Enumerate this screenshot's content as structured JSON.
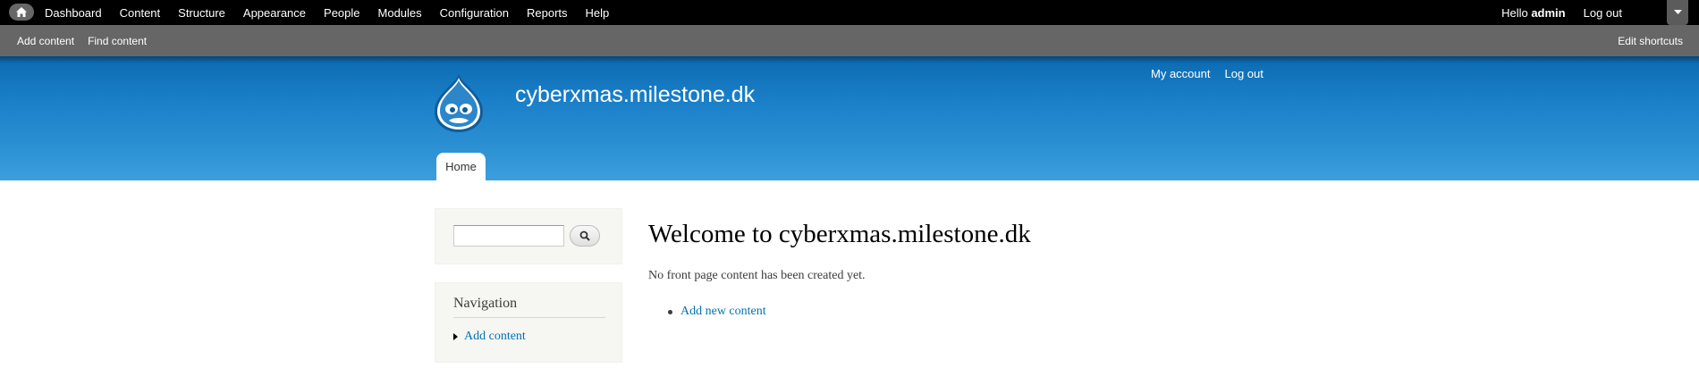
{
  "toolbar": {
    "home_icon": "home-icon",
    "menu": [
      {
        "label": "Dashboard"
      },
      {
        "label": "Content"
      },
      {
        "label": "Structure"
      },
      {
        "label": "Appearance"
      },
      {
        "label": "People"
      },
      {
        "label": "Modules"
      },
      {
        "label": "Configuration"
      },
      {
        "label": "Reports"
      },
      {
        "label": "Help"
      }
    ],
    "hello_prefix": "Hello",
    "username": "admin",
    "logout_label": "Log out",
    "drawer_icon": "chevron-down-icon"
  },
  "shortcuts": {
    "items": [
      {
        "label": "Add content"
      },
      {
        "label": "Find content"
      }
    ],
    "edit_label": "Edit shortcuts"
  },
  "header": {
    "logo_icon": "drupal-drop-logo",
    "site_name": "cyberxmas.milestone.dk",
    "secondary_menu": [
      {
        "label": "My account"
      },
      {
        "label": "Log out"
      }
    ],
    "main_tab": "Home",
    "colors": {
      "gradient_top": "#0b6ab0",
      "gradient_bottom": "#3c9edd"
    }
  },
  "sidebar": {
    "search": {
      "value": "",
      "button_icon": "search-icon"
    },
    "navigation": {
      "title": "Navigation",
      "items": [
        {
          "label": "Add content"
        }
      ]
    }
  },
  "main": {
    "title": "Welcome to cyberxmas.milestone.dk",
    "message": "No front page content has been created yet.",
    "links": [
      {
        "label": "Add new content"
      }
    ]
  },
  "colors": {
    "toolbar_bg": "#000000",
    "shortcut_bg": "#666666",
    "link": "#0071b3",
    "sidebar_bg": "#f6f6f2"
  }
}
